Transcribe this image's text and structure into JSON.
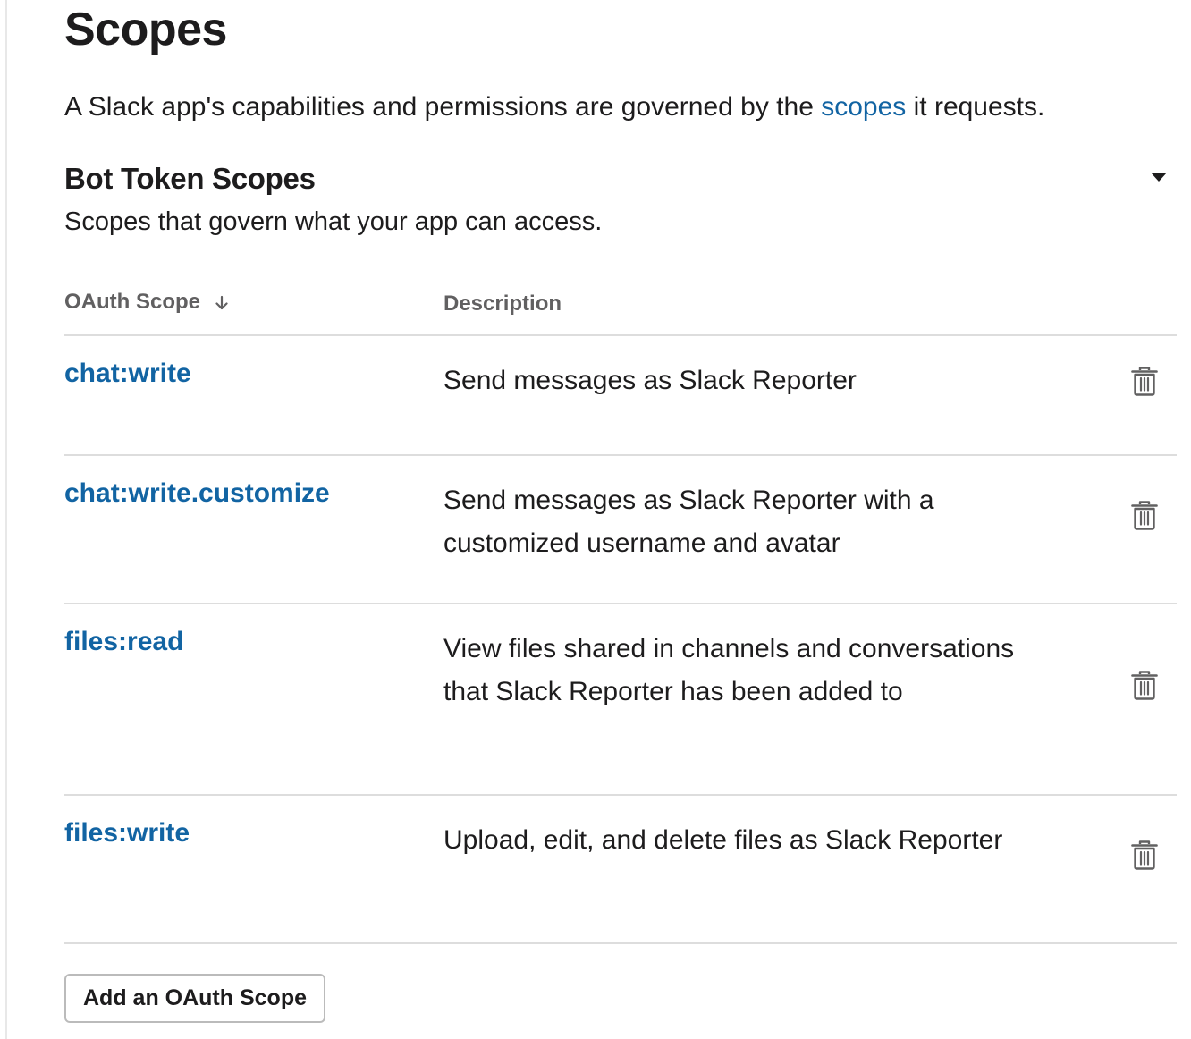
{
  "page": {
    "title": "Scopes",
    "intro_before": "A Slack app's capabilities and permissions are governed by the ",
    "intro_link": "scopes",
    "intro_after": " it requests."
  },
  "section": {
    "title": "Bot Token Scopes",
    "subtitle": "Scopes that govern what your app can access.",
    "toggle_icon": "caret-down-icon"
  },
  "table": {
    "headers": {
      "scope": "OAuth Scope",
      "description": "Description"
    },
    "sort_icon": "arrow-down-icon",
    "rows": [
      {
        "scope": "chat:write",
        "description": "Send messages as Slack Reporter"
      },
      {
        "scope": "chat:write.customize",
        "description": "Send messages as Slack Reporter with a customized username and avatar"
      },
      {
        "scope": "files:read",
        "description": "View files shared in channels and conversations that Slack Reporter has been added to"
      },
      {
        "scope": "files:write",
        "description": "Upload, edit, and delete files as Slack Reporter"
      }
    ],
    "row_action_icon": "trash-icon"
  },
  "actions": {
    "add_scope_label": "Add an OAuth Scope"
  },
  "colors": {
    "link": "#1264a3",
    "text": "#1d1c1d",
    "muted": "#616061",
    "divider": "#dddddd"
  }
}
